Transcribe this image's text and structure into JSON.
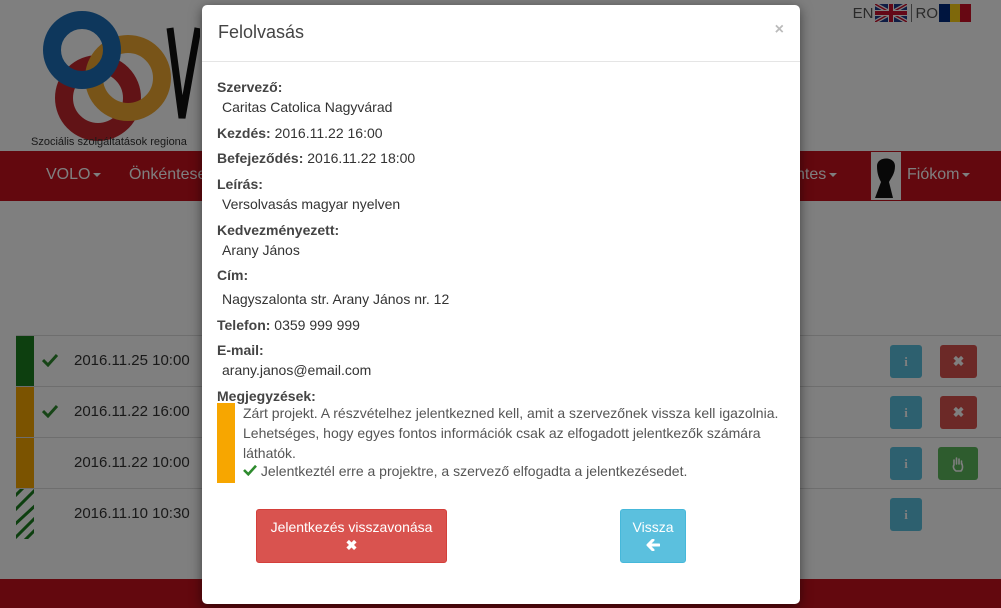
{
  "background": {
    "tagline": "Szociális szolgáltatások regiona",
    "languages": [
      {
        "code": "EN",
        "flag": "uk-flag-icon"
      },
      {
        "code": "RO",
        "flag": "romania-flag-icon"
      }
    ],
    "nav": {
      "volo": "VOLO",
      "onkentes": "Önkéntese",
      "tes": "ntes",
      "account": "Fiókom"
    },
    "rows": [
      {
        "date": "2016.11.25 10:00",
        "bar_color": "#1a7f1e",
        "checked": true
      },
      {
        "date": "2016.11.22 16:00",
        "bar_color": "#f7a600",
        "checked": true
      },
      {
        "date": "2016.11.22 10:00",
        "bar_color": "#f7a600",
        "checked": false
      },
      {
        "date": "2016.11.10 10:30",
        "bar_color": "striped-green",
        "checked": false
      }
    ],
    "brand_red": "#c6101d"
  },
  "modal": {
    "title": "Felolvasás",
    "close": "×",
    "fields": {
      "organizer_label": "Szervező:",
      "organizer_value": "Caritas Catolica Nagyvárad",
      "start_label": "Kezdés:",
      "start_value": "2016.11.22 16:00",
      "end_label": "Befejeződés:",
      "end_value": "2016.11.22 18:00",
      "description_label": "Leírás:",
      "description_value": "Versolvasás magyar nyelven",
      "beneficiary_label": "Kedvezményezett:",
      "beneficiary_value": "Arany János",
      "address_label": "Cím:",
      "address_value": "Nagyszalonta str. Arany János nr. 12",
      "phone_label": "Telefon:",
      "phone_value": "0359 999 999",
      "email_label": "E-mail:",
      "email_value": "arany.janos@email.com",
      "notes_label": "Megjegyzések:"
    },
    "notice": {
      "text": "Zárt projekt. A részvételhez jelentkezned kell, amit a szervezőnek vissza kell igazolnia. Lehetséges, hogy egyes fontos információk csak az elfogadott jelentkezők számára láthatók.",
      "confirmation": "Jelentkeztél erre a projektre, a szervező elfogadta a jelentkezésedet."
    },
    "buttons": {
      "withdraw_label": "Jelentkezés visszavonása",
      "withdraw_icon": "✖",
      "back_label": "Vissza",
      "back_icon": "🡐"
    }
  }
}
